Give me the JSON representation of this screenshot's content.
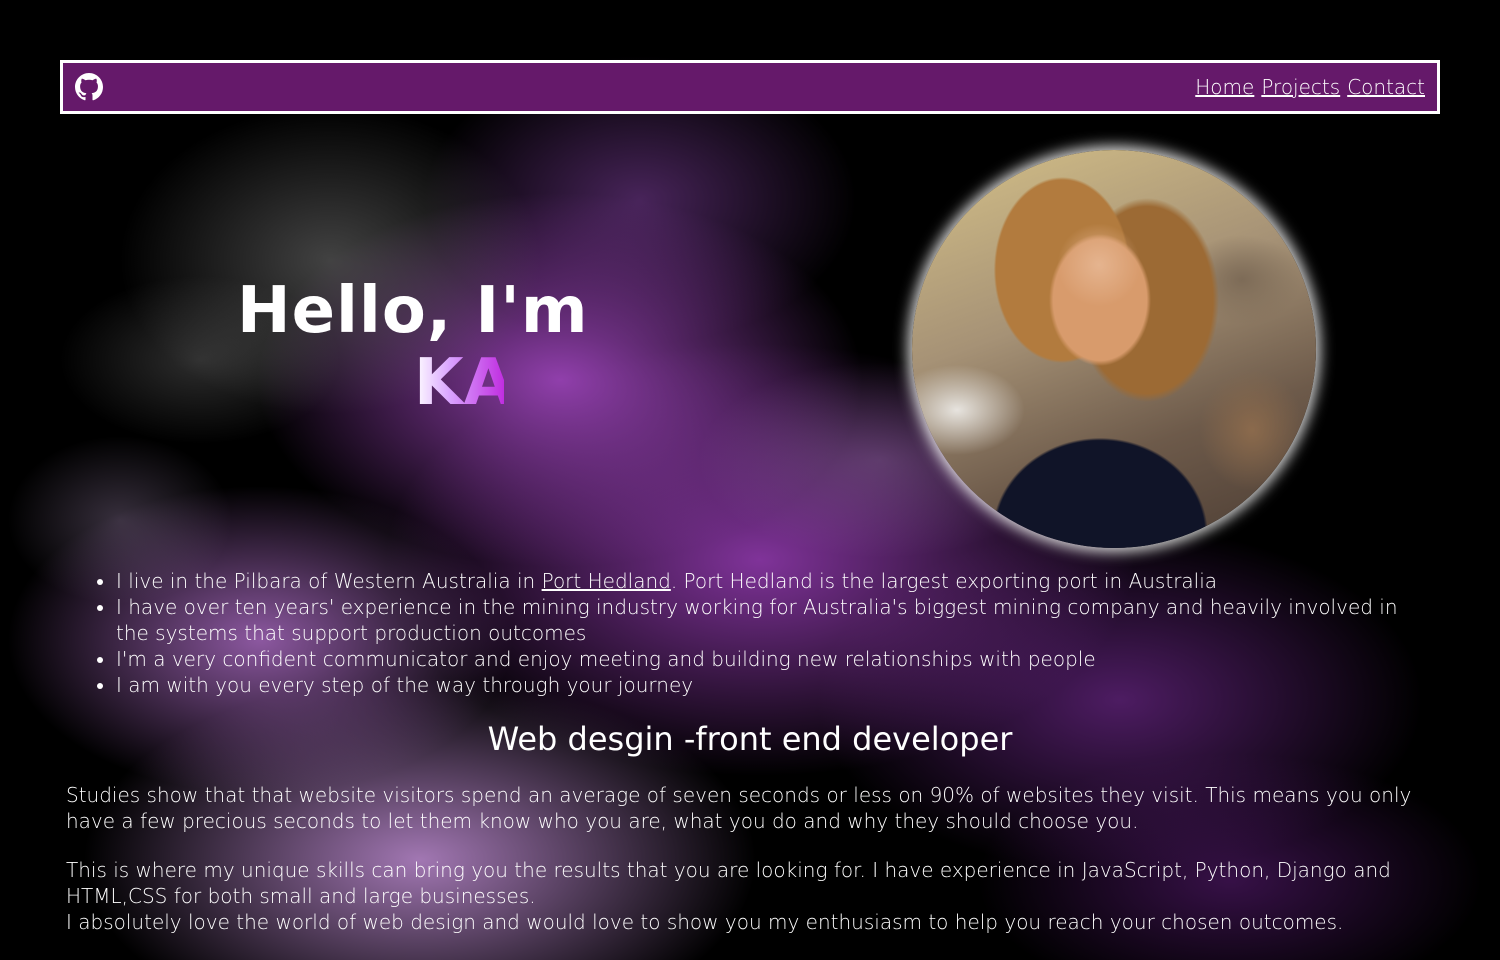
{
  "nav": {
    "github_icon": "github-icon",
    "links": [
      "Home",
      "Projects",
      "Contact"
    ]
  },
  "hero": {
    "greeting": "Hello, I'm",
    "typed_text": "KA"
  },
  "profile": {
    "photo_icon": "profile-photo"
  },
  "about": {
    "items": [
      {
        "before": "I live in the Pilbara of Western Australia in ",
        "link": "Port Hedland",
        "after": ". Port Hedland is the largest exporting port in Australia"
      },
      {
        "text": "I have over ten years' experience in the mining industry working for Australia's biggest mining company and heavily involved in the systems that support production outcomes"
      },
      {
        "text": "I'm a very confident communicator and enjoy meeting and building new relationships with people"
      },
      {
        "text": "I am with you every step of the way through your journey"
      }
    ]
  },
  "section": {
    "title": "Web desgin -front end developer",
    "paragraphs": [
      "Studies show that that website visitors spend an average of seven seconds or less on 90% of websites they visit. This means you only have a few precious seconds to let them know who you are, what you do and why they should choose you.",
      "This is where my unique skills can bring you the results that you are looking for. I have experience in JavaScript, Python, Django and HTML,CSS for both small and large businesses.",
      "I absolutely love the world of web design and would love to show you my enthusiasm to help you reach your chosen outcomes."
    ]
  },
  "colors": {
    "navbar_bg": "#65196a",
    "accent": "#c02ee0"
  }
}
